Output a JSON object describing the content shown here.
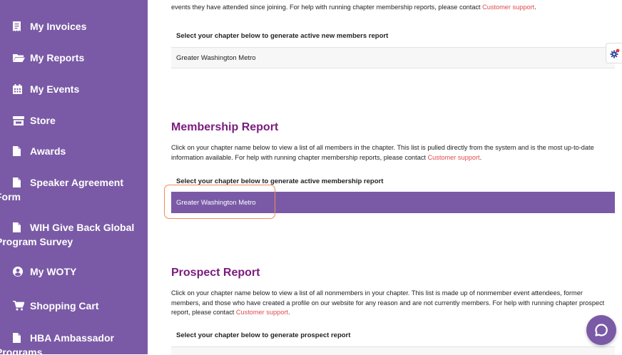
{
  "sidebar": {
    "items": [
      {
        "label": "My Invoices",
        "icon": "receipt-icon"
      },
      {
        "label": "My Reports",
        "icon": "folder-open-icon"
      },
      {
        "label": "My Events",
        "icon": "calendar-icon"
      },
      {
        "label": "Store",
        "icon": "store-icon"
      },
      {
        "label": "Awards",
        "icon": "file-icon"
      },
      {
        "label_lines": [
          "Speaker Agreement",
          "Form"
        ],
        "icon": "file-icon"
      },
      {
        "label_lines": [
          "WIH Give Back Global",
          "Program Survey"
        ],
        "icon": "file-icon"
      },
      {
        "label": "My WOTY",
        "icon": "user-circle-icon"
      },
      {
        "label": "Shopping Cart",
        "icon": "cart-icon"
      },
      {
        "label_lines": [
          "HBA Ambassador",
          "Programs"
        ],
        "icon": "file-icon"
      }
    ]
  },
  "new_members": {
    "text_prefix": "events they have attended since joining. For help with running chapter membership reports, please contact ",
    "link": "Customer support",
    "text_suffix": ".",
    "select_title": "Select your chapter below to generate active new members report",
    "chapter": "Greater Washington Metro"
  },
  "membership": {
    "heading": "Membership Report",
    "text_prefix": "Click on your chapter name below to view a list of all members in the chapter. This list is pulled directly from the system and is the most up-to-date information available. For help with running chapter membership reports, please contact ",
    "link": "Customer support",
    "text_suffix": ".",
    "select_title": "Select your chapter below to generate active membership report",
    "chapter": "Greater Washington Metro"
  },
  "prospect": {
    "heading": "Prospect Report",
    "text_prefix": "Click on your chapter name below to view a list of all nonmembers in your chapter. This list is made up of nonmember event attendees, former members, and those who have created a profile on our website for any reason and are not currently members. For help with running chapter prospect report, please contact ",
    "link": "Customer support",
    "text_suffix": ".",
    "select_title": "Select your chapter below to generate prospect report"
  },
  "colors": {
    "sidebar_bg": "#7a5aa6",
    "heading": "#7b1b7e",
    "link": "#e04b4b",
    "highlight": "#f08b5a"
  }
}
